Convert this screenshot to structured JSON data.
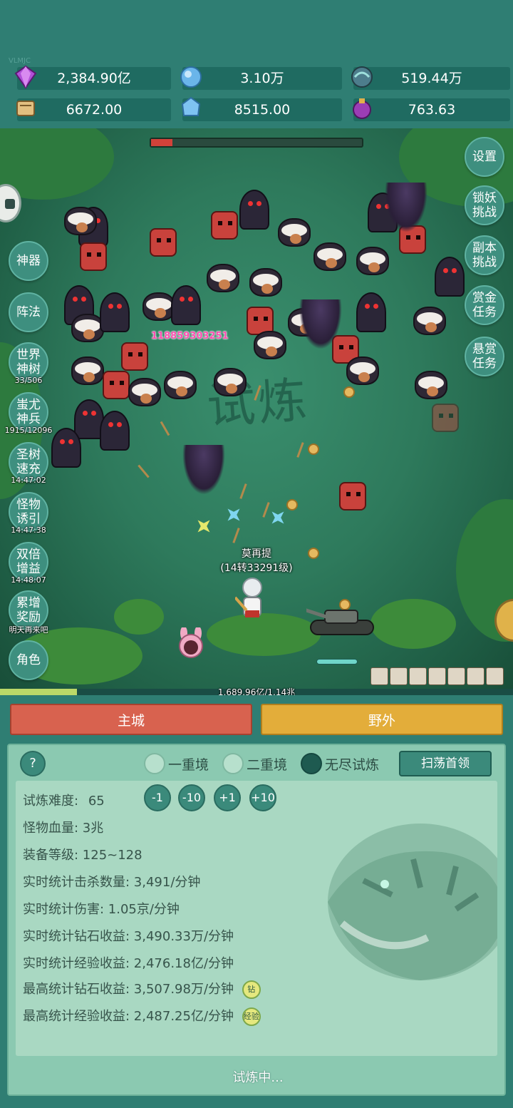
{
  "watermark": "VLMJC",
  "resources": [
    {
      "name": "diamond",
      "value": "2,384.90亿",
      "icon": "gem-purple-icon"
    },
    {
      "name": "crystal",
      "value": "3.10万",
      "icon": "blue-crystal-icon"
    },
    {
      "name": "orb",
      "value": "519.44万",
      "icon": "orb-icon"
    },
    {
      "name": "scroll",
      "value": "6672.00",
      "icon": "scroll-icon"
    },
    {
      "name": "ice",
      "value": "8515.00",
      "icon": "ice-crystal-icon"
    },
    {
      "name": "potion",
      "value": "763.63",
      "icon": "potion-icon"
    }
  ],
  "battle": {
    "bg_title": "试炼",
    "boss_hp_fraction": 0.1,
    "damage_number": "118859303251",
    "player_name": "莫再提",
    "player_level": "(14转33291级)",
    "exp_text": "1,689.96亿/1.14兆",
    "exp_fraction": 0.15
  },
  "left_menu": [
    {
      "label": "神器",
      "sub": ""
    },
    {
      "label": "阵法",
      "sub": ""
    },
    {
      "label": "世界神树",
      "sub": "33/506"
    },
    {
      "label": "蚩尤神兵",
      "sub": "1915/12096"
    },
    {
      "label": "圣树速充",
      "sub": "14:47:02"
    },
    {
      "label": "怪物诱引",
      "sub": "14:47:38"
    },
    {
      "label": "双倍增益",
      "sub": "14:48:07"
    },
    {
      "label": "累增奖励",
      "sub": "明天再来吧"
    },
    {
      "label": "角色",
      "sub": ""
    }
  ],
  "right_menu": [
    {
      "label": "设置"
    },
    {
      "label": "锁妖挑战"
    },
    {
      "label": "副本挑战"
    },
    {
      "label": "赏金任务"
    },
    {
      "label": "悬赏任务"
    }
  ],
  "tabs": {
    "city": "主城",
    "wild": "野外"
  },
  "panel": {
    "help": "?",
    "modes": [
      {
        "label": "一重境",
        "selected": false
      },
      {
        "label": "二重境",
        "selected": false
      },
      {
        "label": "无尽试炼",
        "selected": true
      }
    ],
    "sweep_label": "扫荡首领",
    "difficulty_label": "试炼难度:",
    "difficulty_value": "65",
    "diff_buttons": [
      "-1",
      "-10",
      "+1",
      "+10"
    ],
    "stats": [
      "怪物血量: 3兆",
      "装备等级: 125~128",
      "实时统计击杀数量: 3,491/分钟",
      "实时统计伤害: 1.05京/分钟",
      "实时统计钻石收益: 3,490.33万/分钟",
      "实时统计经验收益: 2,476.18亿/分钟",
      "最高统计钻石收益: 3,507.98万/分钟",
      "最高统计经验收益: 2,487.25亿/分钟"
    ],
    "tag_diamond": "钻",
    "tag_exp": "经验",
    "status": "试炼中..."
  },
  "colors": {
    "bg": "#2f7e73",
    "city_tab": "#d8624f",
    "wild_tab": "#e3ad3a",
    "panel": "#8bc9b1"
  }
}
